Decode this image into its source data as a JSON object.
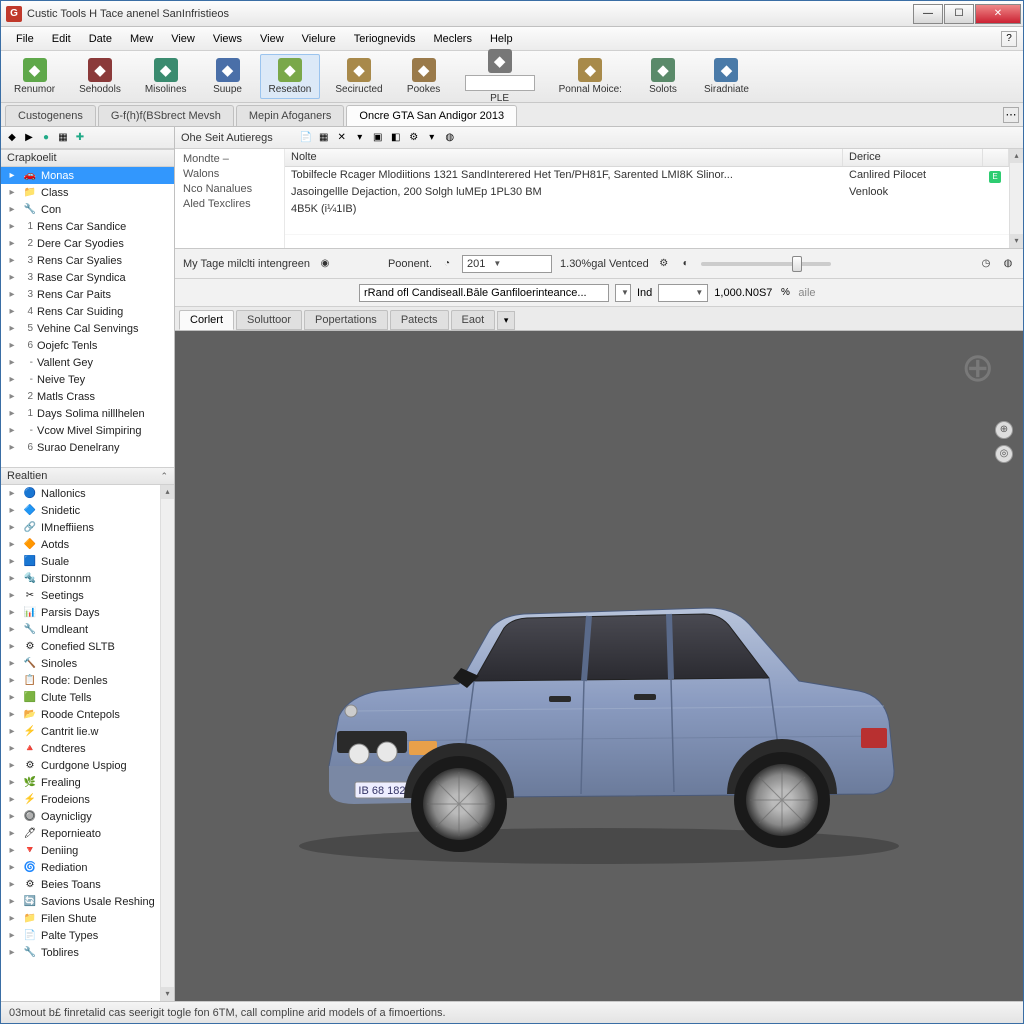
{
  "title": "Custic  Tools H Tace anenel SanInfristieos",
  "menu": [
    "File",
    "Edit",
    "Date",
    "Mew",
    "View",
    "Views",
    "View",
    "Vielure",
    "Teriognevids",
    "Meclers",
    "Help"
  ],
  "toolbar": [
    {
      "label": "Renumor",
      "color": "#5fa84a"
    },
    {
      "label": "Sehodols",
      "color": "#8b3a3a"
    },
    {
      "label": "Misolines",
      "color": "#3a8b6f"
    },
    {
      "label": "Suupe",
      "color": "#4a6fa8"
    },
    {
      "label": "Reseaton",
      "color": "#7aa84a",
      "active": true
    },
    {
      "label": "Seciructed",
      "color": "#a8894a"
    },
    {
      "label": "Pookes",
      "color": "#9a7a4a"
    },
    {
      "label": "PLE",
      "color": "#777",
      "input": true
    },
    {
      "label": "Ponnal Moice:",
      "color": "#a88a4a"
    },
    {
      "label": "Solots",
      "color": "#5a8a6a"
    },
    {
      "label": "Siradniate",
      "color": "#4a7aa8"
    }
  ],
  "main_tabs": [
    "Custogenens",
    "G-f(h)f(BSbrect Mevsh",
    "Mepin Afoganers",
    "Oncre GTA San Andigor 2013"
  ],
  "main_tab_active": 3,
  "left_panel1_hdr": "Crapkoelit",
  "tree1": [
    {
      "ico": "🚗",
      "txt": "Monas",
      "sel": true
    },
    {
      "ico": "📁",
      "txt": "Class"
    },
    {
      "ico": "🔧",
      "txt": "Con"
    },
    {
      "num": "1",
      "txt": "Rens Car Sandice"
    },
    {
      "num": "2",
      "txt": "Dere Car Syodies"
    },
    {
      "num": "3",
      "txt": "Rens Car Syalies"
    },
    {
      "num": "3",
      "txt": "Rase Car Syndica"
    },
    {
      "num": "3",
      "txt": "Rens Car Paits"
    },
    {
      "num": "4",
      "txt": "Rens Car Suiding"
    },
    {
      "num": "5",
      "txt": "Vehine Cal Senvings"
    },
    {
      "num": "6",
      "txt": "Oojefc Tenls"
    },
    {
      "num": "-",
      "txt": "Vallent Gey"
    },
    {
      "num": "-",
      "txt": "Neive Tey"
    },
    {
      "num": "2",
      "txt": "Matls Crass"
    },
    {
      "num": "1",
      "txt": "Days Solima nilllhelen"
    },
    {
      "num": "-",
      "txt": "Vcow Mivel Simpiring"
    },
    {
      "num": "6",
      "txt": "Surao Denelrany"
    }
  ],
  "left_panel2_hdr": "Realtien",
  "tree2": [
    {
      "ico": "🔵",
      "txt": "Nallonics"
    },
    {
      "ico": "🔷",
      "txt": "Snidetic"
    },
    {
      "ico": "🔗",
      "txt": "IMneffiiens"
    },
    {
      "ico": "🔶",
      "txt": "Aotds"
    },
    {
      "ico": "🟦",
      "txt": "Suale"
    },
    {
      "ico": "🔩",
      "txt": "Dirstonnm"
    },
    {
      "ico": "✂",
      "txt": "Seetings"
    },
    {
      "ico": "📊",
      "txt": "Parsis Days"
    },
    {
      "ico": "🔧",
      "txt": "Umdleant"
    },
    {
      "ico": "⚙",
      "txt": "Conefied SLTB"
    },
    {
      "ico": "🔨",
      "txt": "Sinoles"
    },
    {
      "ico": "📋",
      "txt": "Rode: Denles"
    },
    {
      "ico": "🟩",
      "txt": "Clute Tells"
    },
    {
      "ico": "📂",
      "txt": "Roode Cntepols"
    },
    {
      "ico": "⚡",
      "txt": "Cantrit lie.w"
    },
    {
      "ico": "🔺",
      "txt": "Cndteres"
    },
    {
      "ico": "⚙",
      "txt": "Curdgone Uspiog"
    },
    {
      "ico": "🌿",
      "txt": "Frealing"
    },
    {
      "ico": "⚡",
      "txt": "Frodeions"
    },
    {
      "ico": "🔘",
      "txt": "Oaynicligy"
    },
    {
      "ico": "🖊",
      "txt": "Repornieato"
    },
    {
      "ico": "🔻",
      "txt": "Deniing"
    },
    {
      "ico": "🌀",
      "txt": "Rediation"
    },
    {
      "ico": "⚙",
      "txt": "Beies Toans"
    },
    {
      "ico": "🔄",
      "txt": "Savions Usale Reshing"
    },
    {
      "ico": "📁",
      "txt": "Filen Shute"
    },
    {
      "ico": "📄",
      "txt": "Palte Types"
    },
    {
      "ico": "🔧",
      "txt": "Toblires"
    }
  ],
  "detail_header": "Ohe Seit Autieregs",
  "detail_labels": [
    "Mondte –",
    "Walons",
    "Nco Nanalues",
    "Aled Texclires"
  ],
  "detail_cols": [
    "Nolte",
    "Derice",
    ""
  ],
  "detail_rows": [
    {
      "c1": "Tobilfecle Rcager Mlodiitions 1321 SandInterered Het Ten/PH81F, Sarented LMI8K Slinor...",
      "c2": "Canlired Pilocet",
      "c3": "E"
    },
    {
      "c1": "Jasoingellle Dejaction, 200 Solgh luMEp 1PL30 BM",
      "c2": "Venlook",
      "c3": ""
    },
    {
      "c1": "4B5K (i¼1IB)",
      "c2": "",
      "c3": ""
    }
  ],
  "param1": {
    "lbl1": "My Tage milclti intengreen",
    "lbl2": "Poonent.",
    "val": "201",
    "lbl3": "1.30%gal Ventced"
  },
  "param2": {
    "combo": "rRand ofl Candiseall.Bāle Ganfiloerinteance...",
    "lbl": "Ind",
    "val": "1,000.N0S7",
    "unit": "aile"
  },
  "view_tabs": [
    "Corlert",
    "Soluttoor",
    "Popertations",
    "Patects",
    "Eaot"
  ],
  "status": "03mout b£ finretalid cas seerigit togle fon 6TM, call compline arid models of a fimoertions."
}
